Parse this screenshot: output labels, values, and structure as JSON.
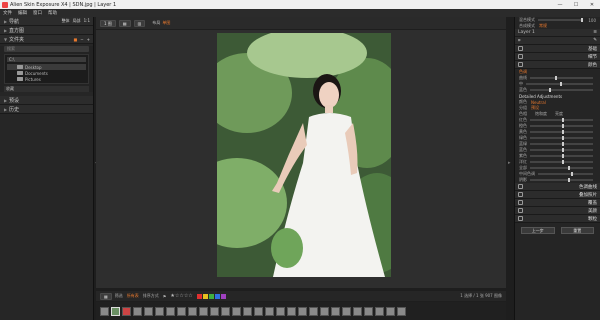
{
  "window": {
    "title": "Alien Skin Exposure X4 | SDN.jpg | Layer 1",
    "minimize": "—",
    "maximize": "☐",
    "close": "✕"
  },
  "menu": [
    "文件",
    "编辑",
    "窗口",
    "帮助"
  ],
  "left": {
    "nav": "导航",
    "nav_tabs": [
      "整体",
      "局部",
      "1:1"
    ],
    "histogram": "直方图",
    "folders": "文件夹",
    "search_placeholder": "搜索",
    "path": "C:\\",
    "tree": [
      "Desktop",
      "Documents",
      "Pictures"
    ],
    "favorites": "收藏",
    "presets": "预设",
    "history": "历史"
  },
  "toolbar": {
    "mode_btn": "1 图",
    "layout_label": "布局",
    "layout_value": "单图"
  },
  "filmbar": {
    "stars": "★☆☆☆☆",
    "filter_label": "筛选",
    "filter_value": "所有表",
    "sort_label": "排序方式",
    "status": "1 选择 / 1 张 907 图像",
    "colors": [
      "#e03030",
      "#e8c020",
      "#40b040",
      "#3070e0",
      "#a040c0"
    ]
  },
  "right": {
    "opacity_label": "混合模式",
    "opacity_value": "100",
    "blend_label": "合成模式",
    "blend_value": "常规",
    "layer": "Layer 1",
    "panels_top": [
      "基础",
      "细节",
      "颜色"
    ],
    "tone_label": "色调",
    "curves_label": "曲线",
    "mid": "中",
    "blue_label": "蓝色",
    "detailed_adjustments": "Detailed Adjustments",
    "color_mode_label": "颜色",
    "color_mode_value": "Neutral",
    "preset_label": "分组",
    "preset_value": "预设",
    "hsl_cols": [
      "色相",
      "饱和度",
      "亮度"
    ],
    "sliders": [
      "红色",
      "橙色",
      "黄色",
      "绿色",
      "蓝绿",
      "蓝色",
      "紫色",
      "洋红"
    ],
    "more_sliders": [
      "全部",
      "中间色调",
      "阴影"
    ],
    "panels_bottom": [
      "色调曲线",
      "叠加照片",
      "覆盖",
      "美颜",
      "颗粒"
    ],
    "buttons": [
      "上一步",
      "重置"
    ]
  }
}
